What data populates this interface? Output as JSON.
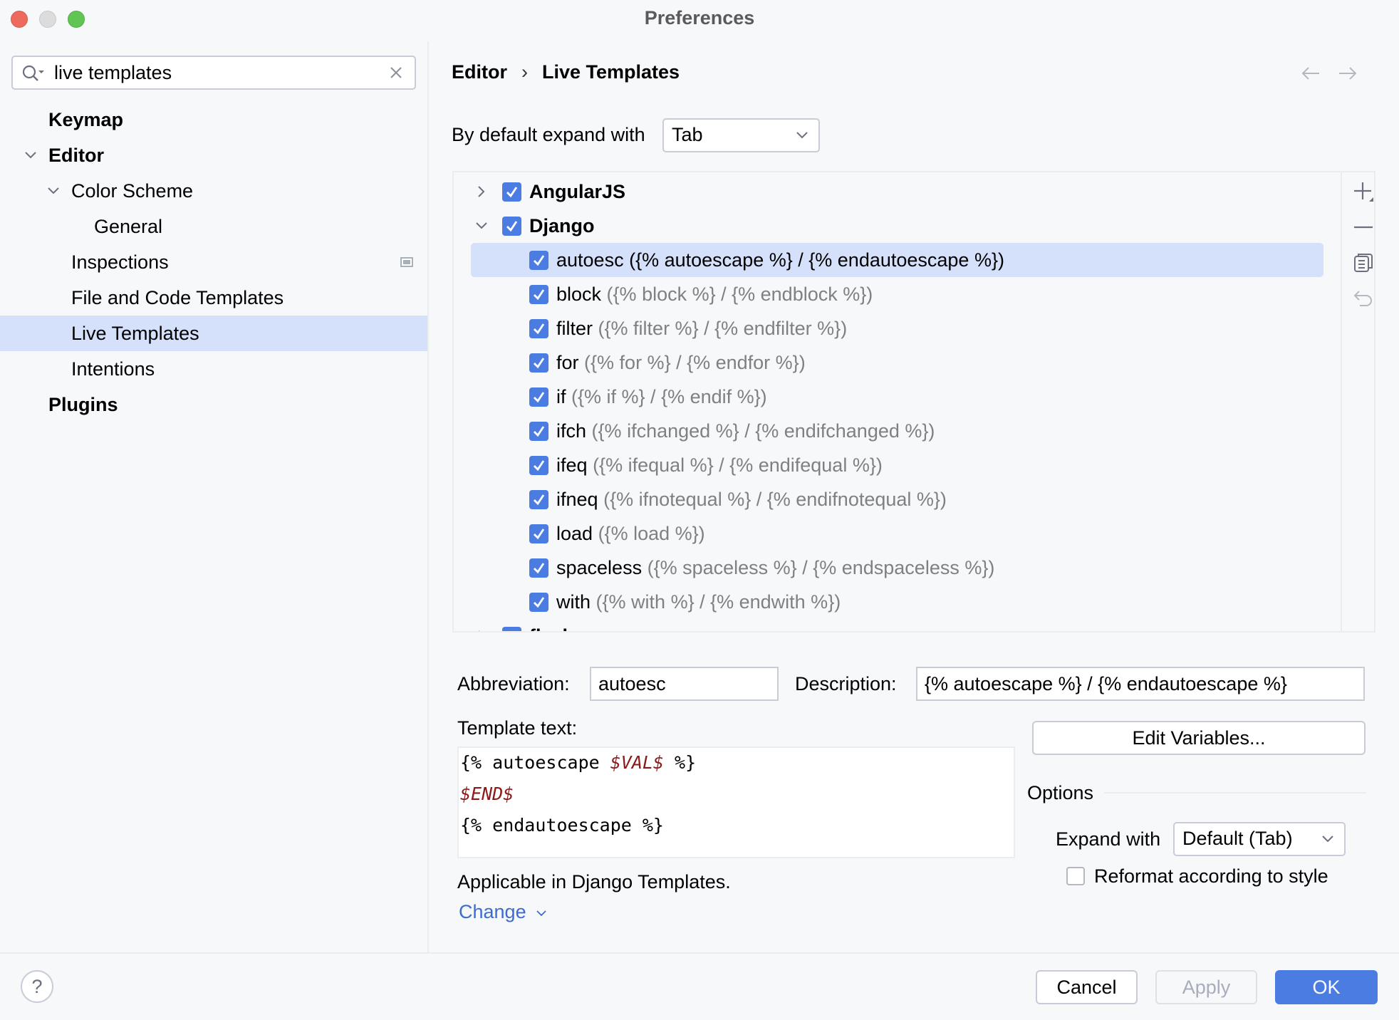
{
  "window": {
    "title": "Preferences"
  },
  "sidebar": {
    "search": {
      "value": "live templates",
      "placeholder": ""
    },
    "items": [
      {
        "label": "Keymap",
        "bold": true,
        "level": 0,
        "expanded": null
      },
      {
        "label": "Editor",
        "bold": true,
        "level": 0,
        "expanded": true
      },
      {
        "label": "Color Scheme",
        "bold": false,
        "level": 1,
        "expanded": true
      },
      {
        "label": "General",
        "bold": false,
        "level": 2,
        "expanded": null
      },
      {
        "label": "Inspections",
        "bold": false,
        "level": 1,
        "expanded": null,
        "icon": "project-settings-icon"
      },
      {
        "label": "File and Code Templates",
        "bold": false,
        "level": 1,
        "expanded": null
      },
      {
        "label": "Live Templates",
        "bold": false,
        "level": 1,
        "expanded": null,
        "selected": true
      },
      {
        "label": "Intentions",
        "bold": false,
        "level": 1,
        "expanded": null
      },
      {
        "label": "Plugins",
        "bold": true,
        "level": 0,
        "expanded": null
      }
    ]
  },
  "header": {
    "breadcrumb": [
      "Editor",
      "Live Templates"
    ],
    "breadcrumb_separator": "›",
    "back_icon": "arrow-left-icon",
    "forward_icon": "arrow-right-icon"
  },
  "expand_default": {
    "label": "By default expand with",
    "value": "Tab"
  },
  "template_list": {
    "groups": [
      {
        "name": "AngularJS",
        "checked": true,
        "expanded": false
      },
      {
        "name": "Django",
        "checked": true,
        "expanded": true
      },
      {
        "name": "flask",
        "checked": true,
        "expanded": false
      }
    ],
    "django_items": [
      {
        "abbr": "autoesc",
        "desc": "({% autoescape %} / {% endautoescape %})",
        "checked": true,
        "selected": true
      },
      {
        "abbr": "block",
        "desc": "({% block %} / {% endblock %})",
        "checked": true
      },
      {
        "abbr": "filter",
        "desc": "({% filter %} / {% endfilter %})",
        "checked": true
      },
      {
        "abbr": "for",
        "desc": "({% for %} / {% endfor %})",
        "checked": true
      },
      {
        "abbr": "if",
        "desc": "({% if %} / {% endif %})",
        "checked": true
      },
      {
        "abbr": "ifch",
        "desc": "({% ifchanged %} / {% endifchanged %})",
        "checked": true
      },
      {
        "abbr": "ifeq",
        "desc": "({% ifequal %} / {% endifequal %})",
        "checked": true
      },
      {
        "abbr": "ifneq",
        "desc": "({% ifnotequal %} / {% endifnotequal %})",
        "checked": true
      },
      {
        "abbr": "load",
        "desc": "({% load %})",
        "checked": true
      },
      {
        "abbr": "spaceless",
        "desc": "({% spaceless %} / {% endspaceless %})",
        "checked": true
      },
      {
        "abbr": "with",
        "desc": "({% with %} / {% endwith %})",
        "checked": true
      }
    ],
    "toolbar": [
      "add-icon",
      "remove-icon",
      "copy-icon",
      "restore-icon"
    ]
  },
  "editor": {
    "abbreviation_label": "Abbreviation:",
    "abbreviation_value": "autoesc",
    "description_label": "Description:",
    "description_value": "{% autoescape %} / {% endautoescape %}",
    "template_text_label": "Template text:",
    "template_lines": [
      [
        {
          "t": "{% autoescape ",
          "var": false
        },
        {
          "t": "$VAL$",
          "var": true
        },
        {
          "t": " %}",
          "var": false
        }
      ],
      [
        {
          "t": "$END$",
          "var": true
        }
      ],
      [
        {
          "t": "{% endautoescape %}",
          "var": false
        }
      ]
    ],
    "edit_variables_label": "Edit Variables...",
    "options_label": "Options",
    "expand_with_label": "Expand with",
    "expand_with_value": "Default (Tab)",
    "reformat_label": "Reformat according to style",
    "reformat_checked": false,
    "applicable_text": "Applicable in Django Templates.",
    "change_label": "Change"
  },
  "footer": {
    "help_label": "?",
    "cancel_label": "Cancel",
    "apply_label": "Apply",
    "ok_label": "OK"
  },
  "colors": {
    "accent": "#4a7ce2",
    "selection": "#d5e0fa",
    "link": "#3c6bd1",
    "template_variable": "#8c1a1a",
    "muted_text": "#808080"
  }
}
